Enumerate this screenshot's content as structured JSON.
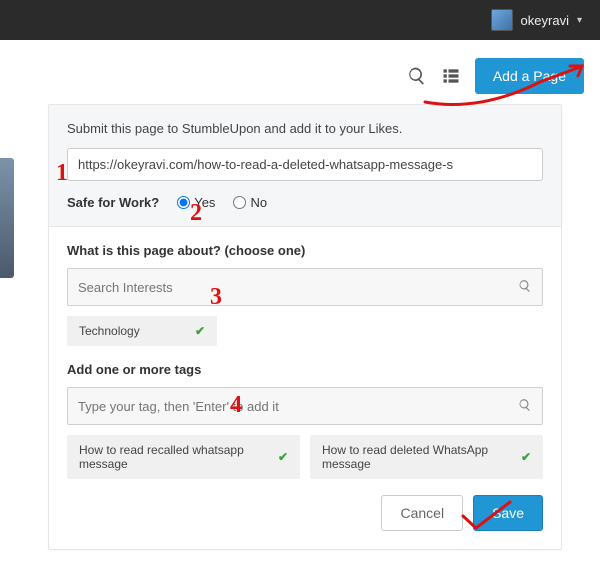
{
  "topbar": {
    "username": "okeyravi"
  },
  "toolbar": {
    "add_page_label": "Add a Page"
  },
  "form": {
    "submit_text": "Submit this page to StumbleUpon and add it to your Likes.",
    "url_value": "https://okeyravi.com/how-to-read-a-deleted-whatsapp-message-s",
    "sfw_label": "Safe for Work?",
    "sfw_yes": "Yes",
    "sfw_no": "No",
    "about_label": "What is this page about? (choose one)",
    "interest_placeholder": "Search Interests",
    "interest_chip": "Technology",
    "tags_label": "Add one or more tags",
    "tags_placeholder": "Type your tag, then 'Enter' to add it",
    "tag_chips": [
      "How to read recalled whatsapp message",
      "How to read deleted WhatsApp message"
    ],
    "cancel_label": "Cancel",
    "save_label": "Save"
  },
  "annotations": {
    "n1": "1",
    "n2": "2",
    "n3": "3",
    "n4": "4"
  }
}
